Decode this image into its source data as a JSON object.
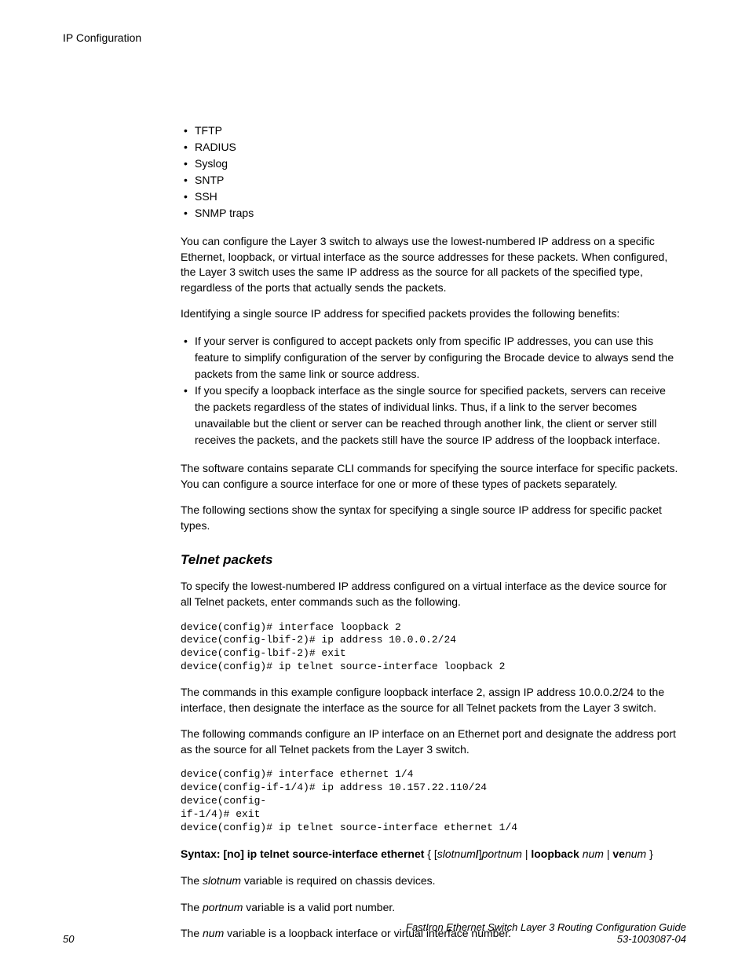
{
  "header": {
    "title": "IP Configuration"
  },
  "protocols": [
    "TFTP",
    "RADIUS",
    "Syslog",
    "SNTP",
    "SSH",
    "SNMP traps"
  ],
  "para1": "You can configure the Layer 3 switch to always use the lowest-numbered IP address on a specific Ethernet, loopback, or virtual interface as the source addresses for these packets. When configured, the Layer 3 switch uses the same IP address as the source for all packets of the specified type, regardless of the ports that actually sends the packets.",
  "para2": "Identifying a single source IP address for specified packets provides the following benefits:",
  "benefits": [
    "If your server is configured to accept packets only from specific IP addresses, you can use this feature to simplify configuration of the server by configuring the Brocade device to always send the packets from the same link or source address.",
    "If you specify a loopback interface as the single source for specified packets, servers can receive the packets regardless of the states of individual links. Thus, if a link to the server becomes unavailable but the client or server can be reached through another link, the client or server still receives the packets, and the packets still have the source IP address of the loopback interface."
  ],
  "para3": "The software contains separate CLI commands for specifying the source interface for specific packets. You can configure a source interface for one or more of these types of packets separately.",
  "para4": "The following sections show the syntax for specifying a single source IP address for specific packet types.",
  "section": {
    "heading": "Telnet packets",
    "intro": "To specify the lowest-numbered IP address configured on a virtual interface as the device source for all Telnet packets, enter commands such as the following.",
    "code1": "device(config)# interface loopback 2\ndevice(config-lbif-2)# ip address 10.0.0.2/24\ndevice(config-lbif-2)# exit\ndevice(config)# ip telnet source-interface loopback 2",
    "para_after_code1": "The commands in this example configure loopback interface 2, assign IP address 10.0.0.2/24 to the interface, then designate the interface as the source for all Telnet packets from the Layer 3 switch.",
    "para_before_code2": "The following commands configure an IP interface on an Ethernet port and designate the address port as the source for all Telnet packets from the Layer 3 switch.",
    "code2": "device(config)# interface ethernet 1/4\ndevice(config-if-1/4)# ip address 10.157.22.110/24\ndevice(config-\nif-1/4)# exit\ndevice(config)# ip telnet source-interface ethernet 1/4",
    "syntax": {
      "prefix": "Syntax: [no] ip telnet source-interface ethernet",
      "open": " { [",
      "slotnum": "slotnum",
      "slash": "/",
      "close1": "]",
      "portnum": "portnum",
      "pipe1": " | ",
      "loopback": "loopback",
      "space1": " ",
      "num1": "num",
      "pipe2": " | ",
      "ve": "ve",
      "num2": "num",
      "close2": " }"
    },
    "note1_pre": "The ",
    "note1_var": "slotnum",
    "note1_post": " variable is required on chassis devices.",
    "note2_pre": "The ",
    "note2_var": "portnum",
    "note2_post": " variable is a valid port number.",
    "note3_pre": "The ",
    "note3_var": "num",
    "note3_post": " variable is a loopback interface or virtual interface number."
  },
  "footer": {
    "page": "50",
    "guide": "FastIron Ethernet Switch Layer 3 Routing Configuration Guide",
    "docnum": "53-1003087-04"
  }
}
